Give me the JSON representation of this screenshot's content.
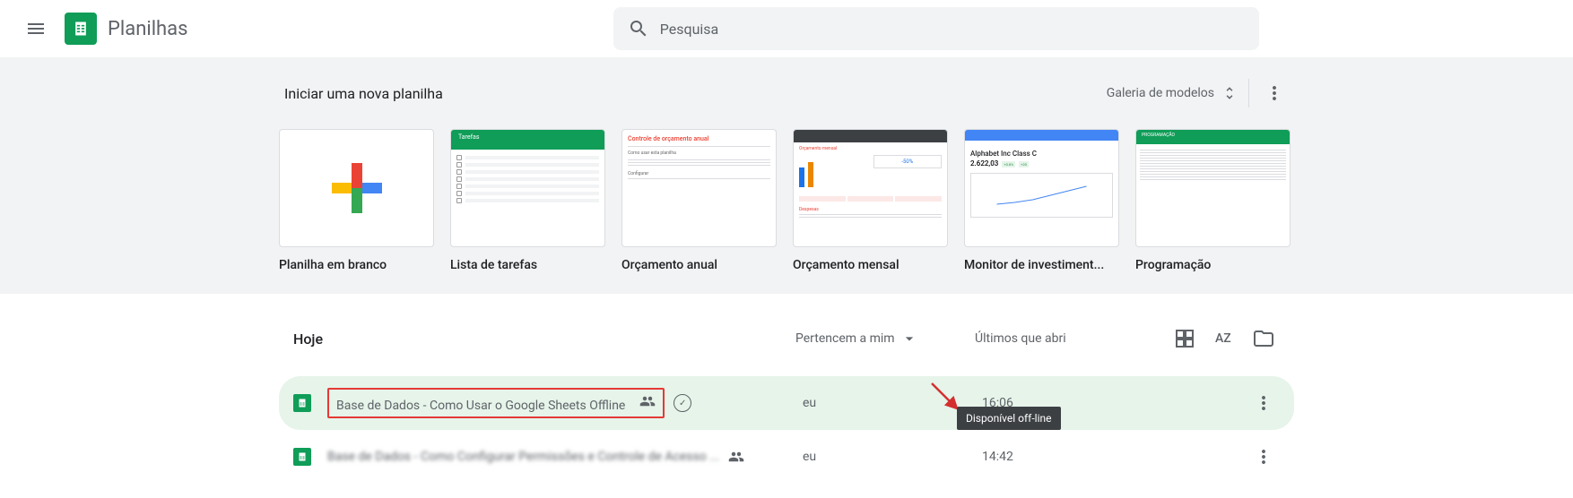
{
  "header": {
    "app_name": "Planilhas",
    "search_placeholder": "Pesquisa"
  },
  "templates": {
    "section_title": "Iniciar uma nova planilha",
    "gallery_label": "Galeria de modelos",
    "items": [
      {
        "label": "Planilha em branco"
      },
      {
        "label": "Lista de tarefas"
      },
      {
        "label": "Orçamento anual"
      },
      {
        "label": "Orçamento mensal"
      },
      {
        "label": "Monitor de investiment..."
      },
      {
        "label": "Programação"
      }
    ],
    "thumb_investment_title": "Alphabet Inc Class C",
    "thumb_investment_value": "2.622,03",
    "thumb_todo_title": "Tarefas",
    "thumb_budget_title": "Controle de orçamento anual",
    "thumb_monthly_title": "Orçamento mensal"
  },
  "files": {
    "section_title": "Hoje",
    "owner_filter": "Pertencem a mim",
    "last_opened_label": "Últimos que abri",
    "rows": [
      {
        "name": "Base de Dados - Como Usar o Google Sheets Offline",
        "owner": "eu",
        "time": "16:06"
      },
      {
        "name": "Base de Dados - Como Configurar Permissões e Controle de Acesso ...",
        "owner": "eu",
        "time": "14:42"
      }
    ]
  },
  "tooltip": "Disponível off-line"
}
